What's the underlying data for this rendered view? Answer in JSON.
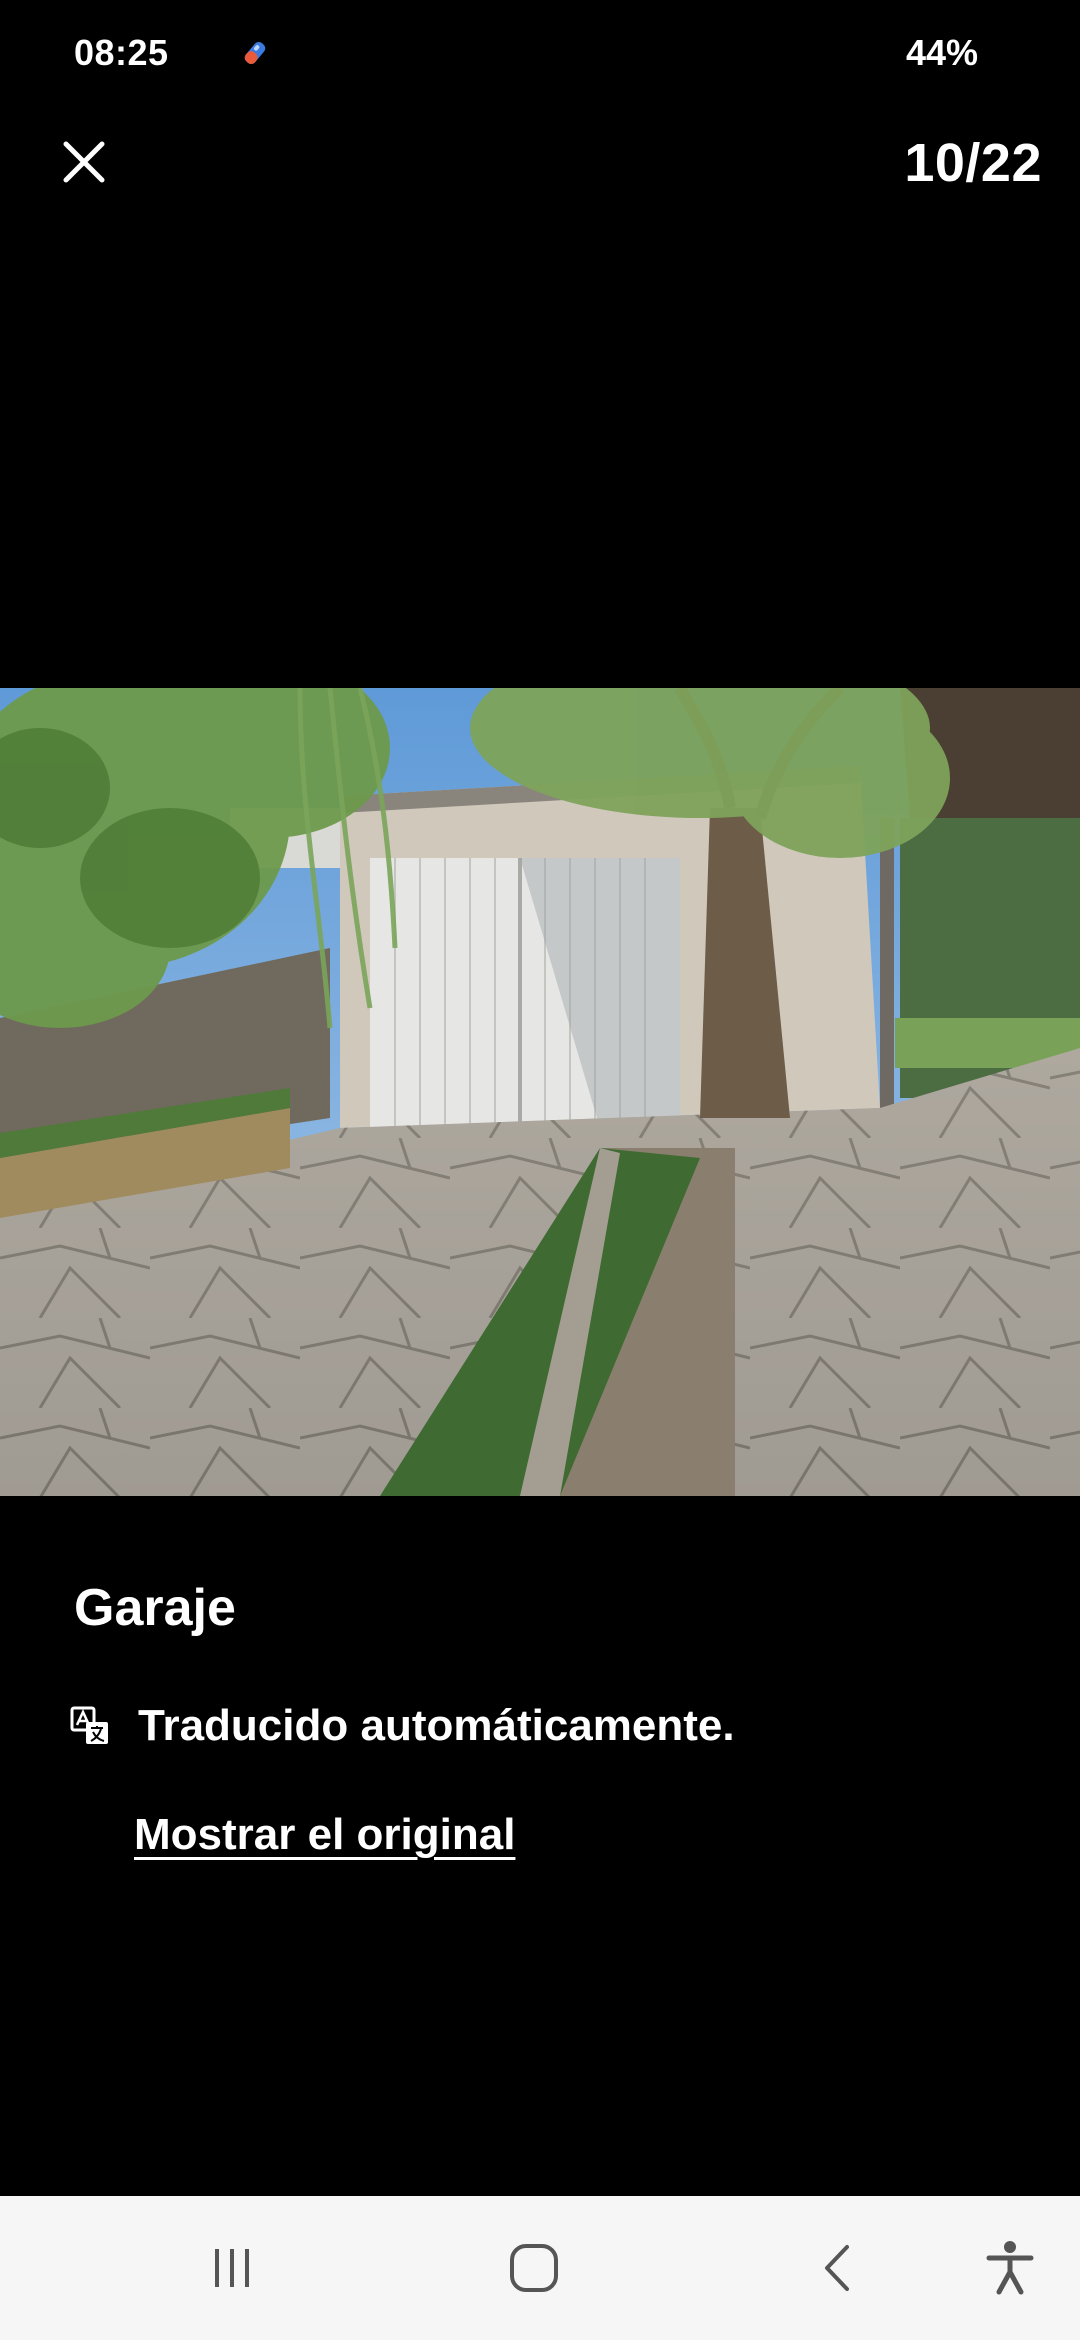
{
  "status_bar": {
    "time": "08:25",
    "battery": "44%",
    "app_icon": "notification-app-icon"
  },
  "viewer": {
    "close_icon": "close-icon",
    "counter": "10/22"
  },
  "photo": {
    "subject": "garage"
  },
  "caption": {
    "title": "Garaje",
    "translation_note": "Traducido automáticamente.",
    "translation_icon": "translate-icon",
    "show_original_link": "Mostrar el original"
  },
  "nav_bar": {
    "recents_icon": "recents-icon",
    "home_icon": "home-icon",
    "back_icon": "back-icon",
    "accessibility_icon": "accessibility-icon"
  },
  "colors": {
    "background": "#000000",
    "text": "#ffffff",
    "nav_bar_bg": "#f6f6f6",
    "nav_icon": "#555555"
  }
}
